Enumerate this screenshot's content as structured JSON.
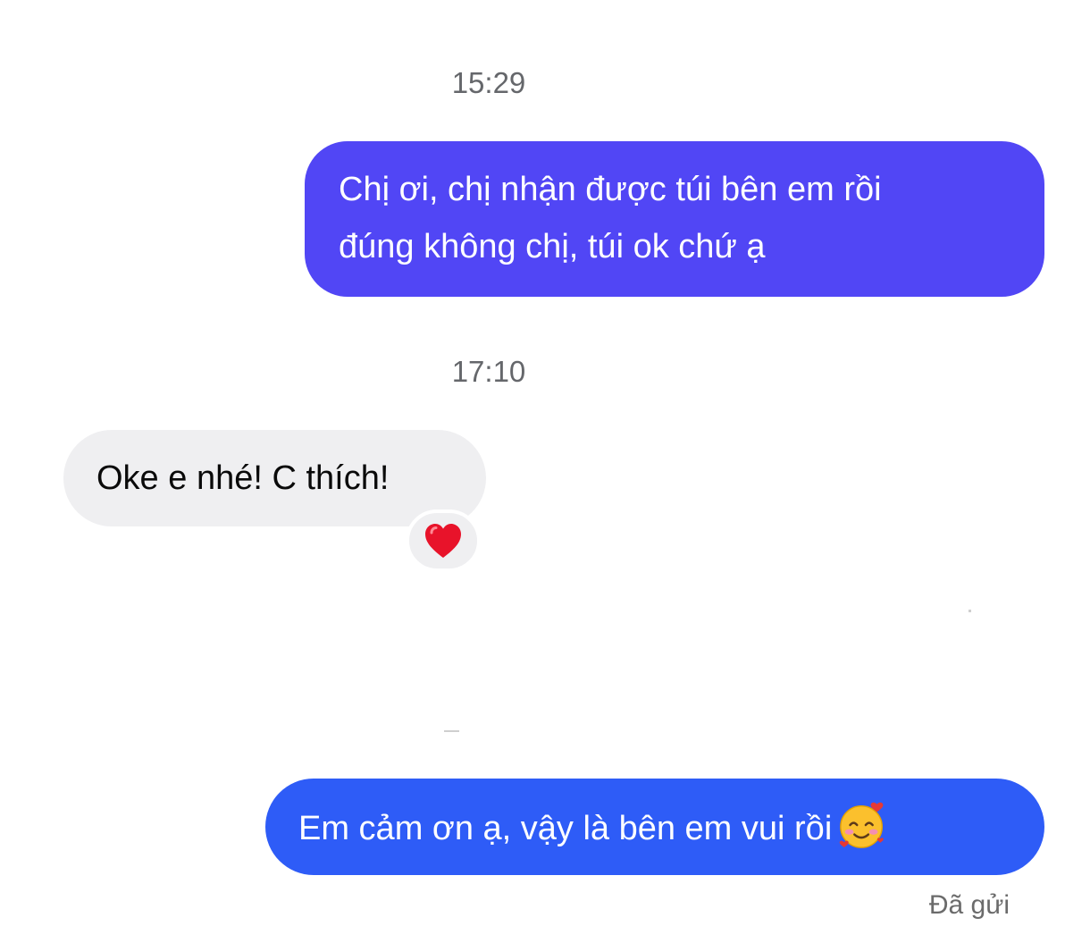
{
  "conversation": {
    "timestamps": [
      "15:29",
      "17:10"
    ],
    "messages": [
      {
        "direction": "outgoing",
        "lines": [
          "Chị ơi, chị nhận được túi bên em rồi",
          "đúng không chị, túi ok chứ ạ"
        ],
        "color": "#5146f5"
      },
      {
        "direction": "incoming",
        "text": "Oke e nhé! C thích!",
        "reaction": "red-heart",
        "color": "#efeff1"
      },
      {
        "direction": "outgoing",
        "text": "Em cảm ơn ạ, vậy là bên em vui rồi",
        "emoji": "smiling-face-with-hearts",
        "color": "#2e5cf7"
      }
    ],
    "status": "Đã gửi"
  }
}
